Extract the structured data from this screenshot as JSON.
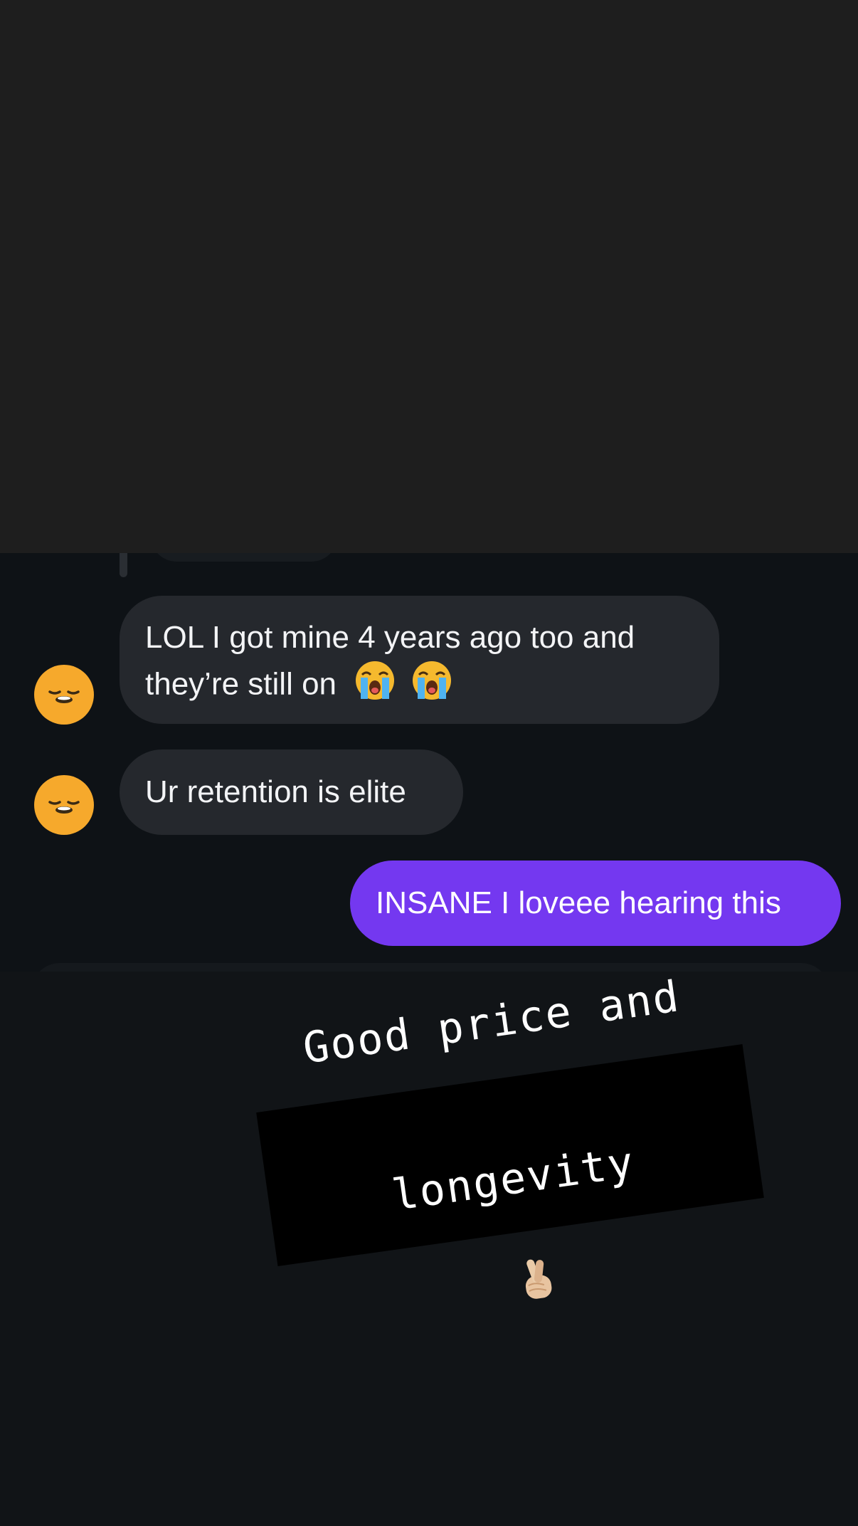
{
  "messages": [
    {
      "sender": "other",
      "text_line1": "LOL I got mine 4 years ago too and",
      "text_line2": "they’re still on",
      "emojis": [
        "loudly-crying-face-emoji",
        "loudly-crying-face-emoji"
      ]
    },
    {
      "sender": "other",
      "text": "Ur retention is elite"
    },
    {
      "sender": "me",
      "text": "INSANE I loveee hearing this"
    }
  ],
  "sticker": {
    "line1": "Good price and",
    "line2": "longevity",
    "emoji": "crossed-fingers-emoji"
  },
  "colors": {
    "top_overlay": "#1e1e1e",
    "chat_background": "#0e1216",
    "incoming_bubble": "#25282d",
    "outgoing_bubble": "#7438f0",
    "avatar": "#f6a92c",
    "sticker_background": "#000000"
  },
  "icons": [
    "sleepy-face-avatar-icon",
    "loudly-crying-face-emoji",
    "crossed-fingers-emoji"
  ]
}
